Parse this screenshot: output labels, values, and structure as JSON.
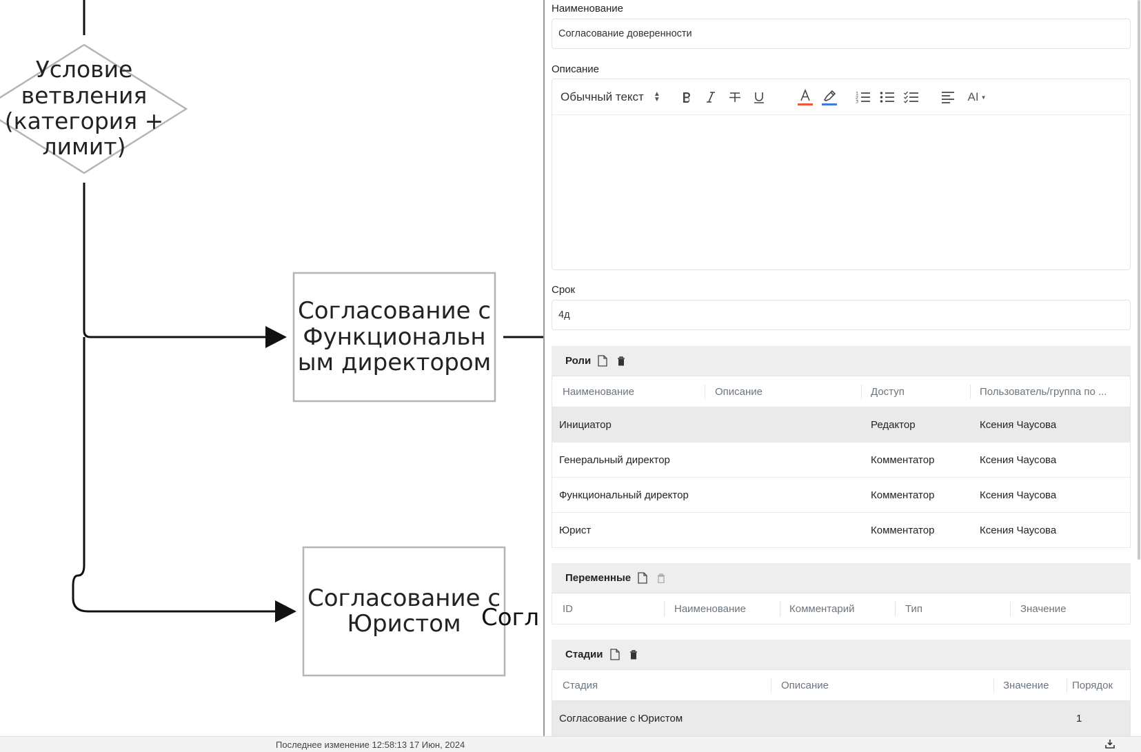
{
  "diagram": {
    "nodes": {
      "condition": [
        "Условие",
        "ветвления",
        "(категория +",
        "лимит)"
      ],
      "task_functional": [
        "Согласование с",
        "Функциональн",
        "ым директором"
      ],
      "task_lawyer": [
        "Согласование с",
        "Юристом"
      ],
      "task_partial": "Согл"
    }
  },
  "form": {
    "name_label": "Наименование",
    "name_value": "Согласование доверенности",
    "description_label": "Описание",
    "editor": {
      "style_select": "Обычный текст",
      "tools": [
        "bold-icon",
        "italic-icon",
        "strikethrough-icon",
        "underline-icon",
        "text-color-icon",
        "highlight-icon",
        "numbered-list-icon",
        "bullet-list-icon",
        "check-list-icon",
        "align-left-icon",
        "ai-icon"
      ],
      "ai_label": "AI",
      "text_color": "#e8593c",
      "highlight_color": "#3d7dd8"
    },
    "deadline_label": "Срок",
    "deadline_value": "4д"
  },
  "roles": {
    "title": "Роли",
    "columns": [
      "Наименование",
      "Описание",
      "Доступ",
      "Пользователь/группа по ..."
    ],
    "rows": [
      {
        "name": "Инициатор",
        "description": "",
        "access": "Редактор",
        "user": "Ксения Чаусова"
      },
      {
        "name": "Генеральный директор",
        "description": "",
        "access": "Комментатор",
        "user": "Ксения Чаусова"
      },
      {
        "name": "Функциональный директор",
        "description": "",
        "access": "Комментатор",
        "user": "Ксения Чаусова"
      },
      {
        "name": "Юрист",
        "description": "",
        "access": "Комментатор",
        "user": "Ксения Чаусова"
      }
    ]
  },
  "variables": {
    "title": "Переменные",
    "columns": [
      "ID",
      "Наименование",
      "Комментарий",
      "Тип",
      "Значение"
    ]
  },
  "stages": {
    "title": "Стадии",
    "columns": [
      "Стадия",
      "Описание",
      "Значение",
      "Порядок"
    ],
    "rows": [
      {
        "stage": "Согласование с Юристом",
        "description": "",
        "value": "",
        "order": "1"
      }
    ]
  },
  "status": {
    "text": "Последнее изменение 12:58:13 17 Июн, 2024"
  }
}
